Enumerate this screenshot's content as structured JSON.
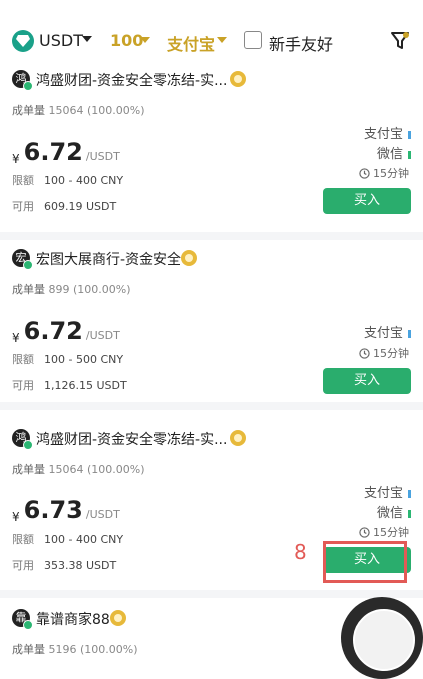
{
  "topbar": {
    "coin": "USDT",
    "amount": "100",
    "payment": "支付宝",
    "newbie": "新手友好"
  },
  "colors": {
    "accent_gold": "#c9a227",
    "buy_green": "#2aad6d",
    "annotation_red": "#e25a56"
  },
  "ads": [
    {
      "avatar": "鸿",
      "merchant": "鸿盛财团-资金安全零冻结-实...",
      "deal_label": "成单量",
      "deal_value": "15064 (100.00%)",
      "currency_sym": "¥",
      "price": "6.72",
      "unit": "/USDT",
      "limit_label": "限额",
      "limit": "100 - 400 CNY",
      "avail_label": "可用",
      "available": "609.19 USDT",
      "methods": [
        {
          "name": "支付宝",
          "color": "#4aa3df"
        },
        {
          "name": "微信",
          "color": "#2bb673"
        }
      ],
      "timer": "15分钟",
      "buy": "买入"
    },
    {
      "avatar": "宏",
      "merchant": "宏图大展商行-资金安全",
      "deal_label": "成单量",
      "deal_value": "899 (100.00%)",
      "currency_sym": "¥",
      "price": "6.72",
      "unit": "/USDT",
      "limit_label": "限额",
      "limit": "100 - 500 CNY",
      "avail_label": "可用",
      "available": "1,126.15 USDT",
      "methods": [
        {
          "name": "支付宝",
          "color": "#4aa3df"
        }
      ],
      "timer": "15分钟",
      "buy": "买入"
    },
    {
      "avatar": "鸿",
      "merchant": "鸿盛财团-资金安全零冻结-实...",
      "deal_label": "成单量",
      "deal_value": "15064 (100.00%)",
      "currency_sym": "¥",
      "price": "6.73",
      "unit": "/USDT",
      "limit_label": "限额",
      "limit": "100 - 400 CNY",
      "avail_label": "可用",
      "available": "353.38 USDT",
      "methods": [
        {
          "name": "支付宝",
          "color": "#4aa3df"
        },
        {
          "name": "微信",
          "color": "#2bb673"
        }
      ],
      "timer": "15分钟",
      "buy": "买入"
    },
    {
      "avatar": "靠",
      "merchant": "靠谱商家88",
      "deal_label": "成单量",
      "deal_value": "5196 (100.00%)"
    }
  ],
  "annotation": {
    "number": "8"
  }
}
